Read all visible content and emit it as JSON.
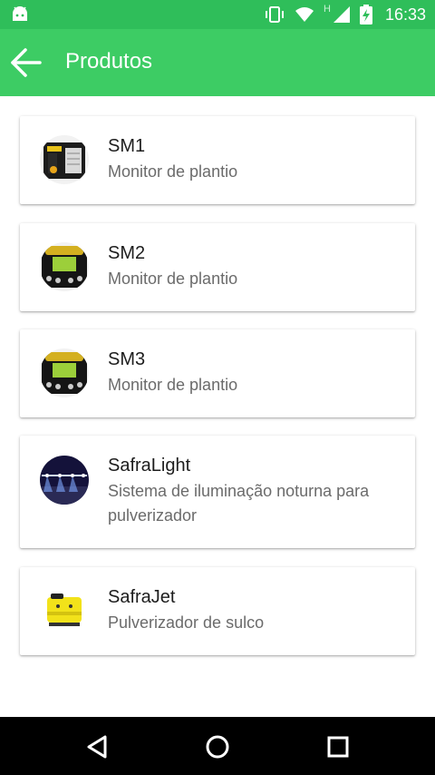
{
  "status_bar": {
    "time": "16:33",
    "network_type": "H",
    "icons": [
      "android-icon",
      "vibrate-icon",
      "wifi-icon",
      "signal-icon",
      "battery-charging-icon"
    ]
  },
  "app_bar": {
    "title": "Produtos",
    "back_icon": "arrow-left-icon",
    "background": "#3dcc64"
  },
  "products": [
    {
      "name": "SM1",
      "description": "Monitor de plantio",
      "thumbnail": "sm1-device-image"
    },
    {
      "name": "SM2",
      "description": "Monitor de plantio",
      "thumbnail": "sm2-device-image"
    },
    {
      "name": "SM3",
      "description": "Monitor de plantio",
      "thumbnail": "sm3-device-image"
    },
    {
      "name": "SafraLight",
      "description": "Sistema de iluminação noturna para pulverizador",
      "thumbnail": "safralight-image"
    },
    {
      "name": "SafraJet",
      "description": "Pulverizador de sulco",
      "thumbnail": "safrajet-image"
    }
  ],
  "nav_bar": {
    "buttons": [
      "back-triangle-icon",
      "home-circle-icon",
      "recents-square-icon"
    ]
  }
}
